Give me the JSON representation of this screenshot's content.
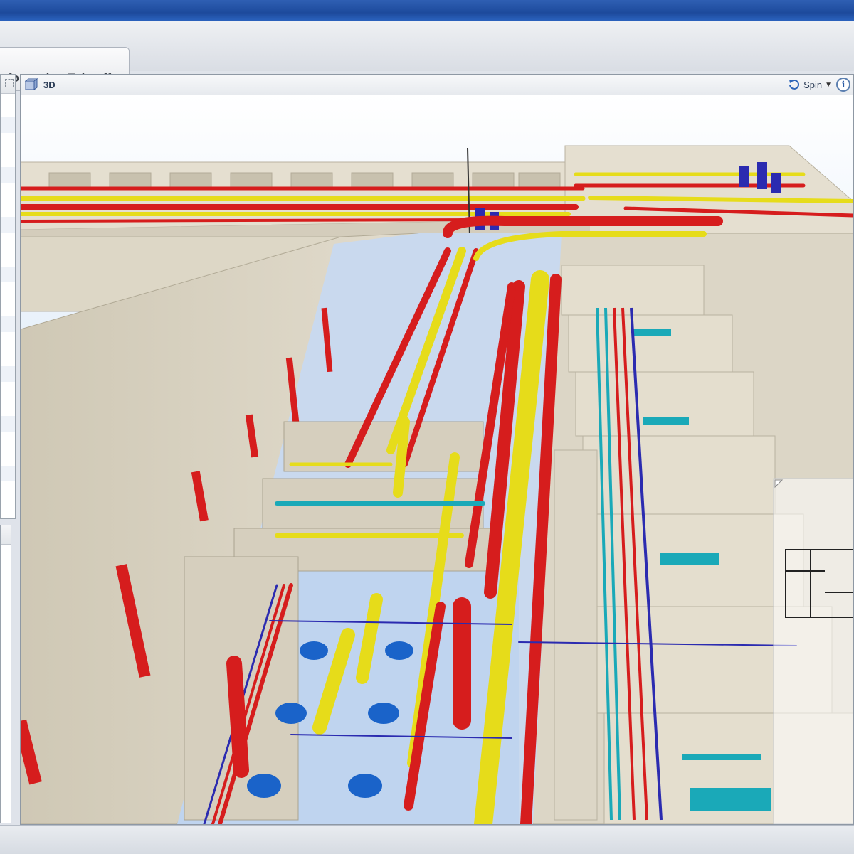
{
  "window": {
    "accent_color": "#1d4a9c"
  },
  "tabs": [
    {
      "label": "nformation Takeoff",
      "active": true
    }
  ],
  "viewer": {
    "title": "3D",
    "view_icon": "cube-view-icon",
    "navigation_mode": "Spin",
    "navigation_icon": "spin-rotate-icon",
    "info_icon": "info-icon",
    "info_glyph": "i",
    "minimap_icon": "overview-map-icon"
  },
  "left_panels": [
    {
      "name": "model-tree-panel",
      "pin_icon": "pin-icon"
    },
    {
      "name": "properties-panel",
      "pin_icon": "pin-icon"
    }
  ],
  "colors": {
    "sky_top": "#ffffff",
    "sky_bottom": "#bcd6f2",
    "wall": "#dcd6c6",
    "floor_shadow": "#cfc8b6",
    "pipe_red": "#d61d1d",
    "pipe_yellow": "#e6dc1a",
    "pipe_cyan": "#1aa9b8",
    "pipe_blue": "#2b2bb0",
    "diffuser_blue": "#1a63c9"
  }
}
